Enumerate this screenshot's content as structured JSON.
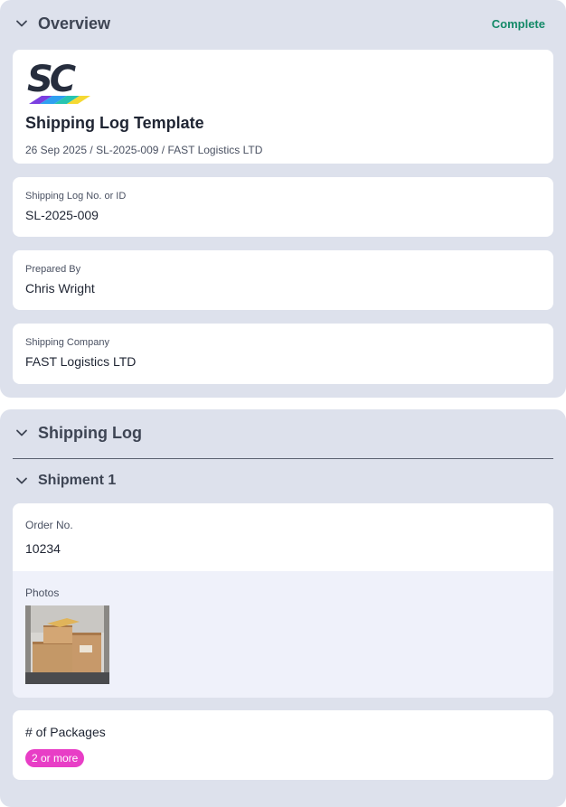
{
  "overview": {
    "title": "Overview",
    "status": "Complete",
    "header_card": {
      "logo_text": "SC",
      "title": "Shipping Log Template",
      "subtitle": "26 Sep 2025 / SL-2025-009 / FAST Logistics LTD"
    },
    "fields": [
      {
        "label": "Shipping Log No. or ID",
        "value": "SL-2025-009"
      },
      {
        "label": "Prepared By",
        "value": "Chris Wright"
      },
      {
        "label": "Shipping Company",
        "value": "FAST Logistics LTD"
      }
    ]
  },
  "shipping_log": {
    "title": "Shipping Log",
    "shipment": {
      "title": "Shipment 1",
      "order_label": "Order No.",
      "order_value": "10234",
      "photos_label": "Photos",
      "packages_label": "# of Packages",
      "packages_value": "2 or more"
    }
  },
  "colors": {
    "section_bg": "#dde1ec",
    "status_green": "#148a68",
    "badge_pink": "#e83ec6"
  },
  "icons": {
    "collapse": "chevron-down-icon"
  }
}
